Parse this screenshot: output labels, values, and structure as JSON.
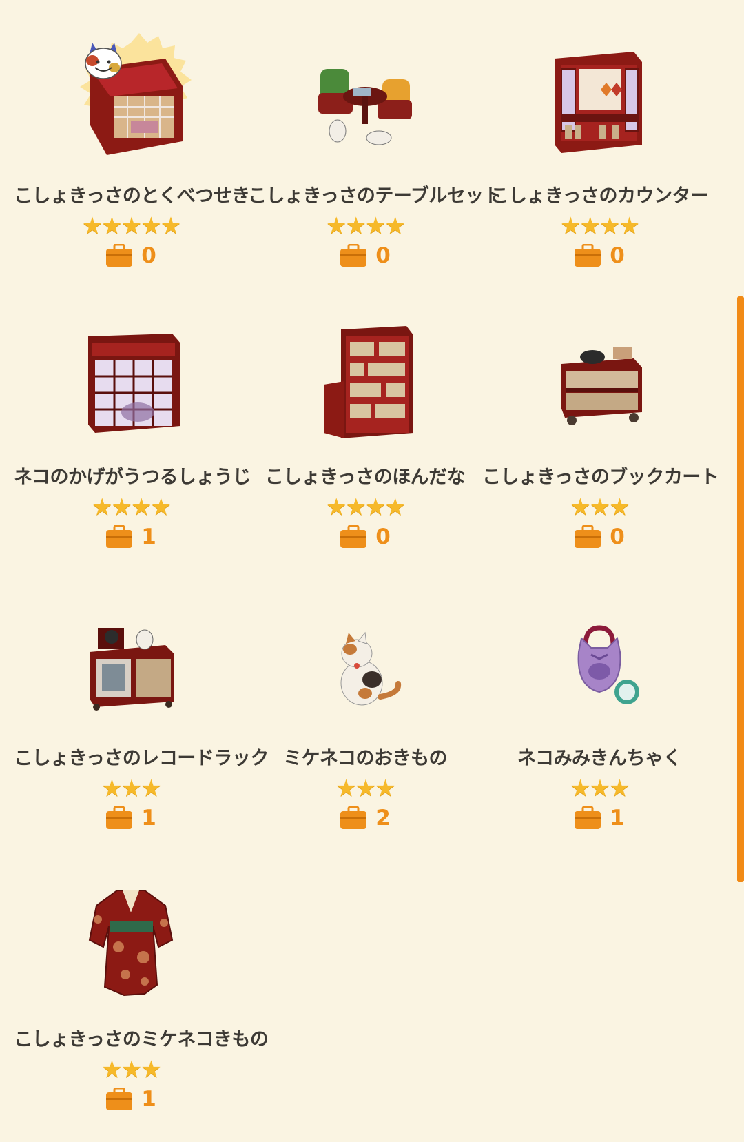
{
  "items": [
    {
      "name": "こしょきっさのとくべつせき",
      "stars": "★★★★★",
      "count": "0",
      "icon": "tatami-room-icon",
      "special": true
    },
    {
      "name": "こしょきっさのテーブルセット",
      "stars": "★★★★",
      "count": "0",
      "icon": "table-set-icon"
    },
    {
      "name": "こしょきっさのカウンター",
      "stars": "★★★★",
      "count": "0",
      "icon": "counter-icon"
    },
    {
      "name": "ネコのかげがうつるしょうじ",
      "stars": "★★★★",
      "count": "1",
      "icon": "shoji-screen-icon"
    },
    {
      "name": "こしょきっさのほんだな",
      "stars": "★★★★",
      "count": "0",
      "icon": "bookshelf-icon"
    },
    {
      "name": "こしょきっさのブックカート",
      "stars": "★★★",
      "count": "0",
      "icon": "book-cart-icon"
    },
    {
      "name": "こしょきっさのレコードラック",
      "stars": "★★★",
      "count": "1",
      "icon": "record-rack-icon"
    },
    {
      "name": "ミケネコのおきもの",
      "stars": "★★★",
      "count": "2",
      "icon": "calico-cat-figurine-icon"
    },
    {
      "name": "ネコみみきんちゃく",
      "stars": "★★★",
      "count": "1",
      "icon": "cat-ear-pouch-icon"
    },
    {
      "name": "こしょきっさのミケネコきもの",
      "stars": "★★★",
      "count": "1",
      "icon": "kimono-icon"
    }
  ],
  "colors": {
    "background": "#faf4e2",
    "text": "#3d3a35",
    "star": "#f6b92a",
    "accent": "#f18a16"
  }
}
